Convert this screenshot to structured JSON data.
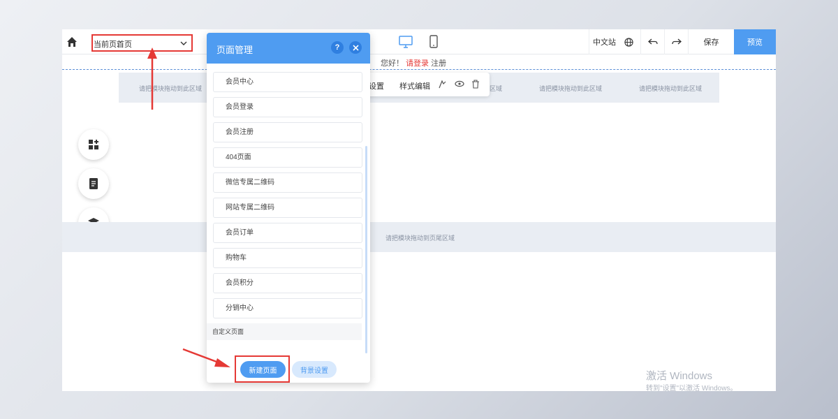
{
  "toolbar": {
    "current_page_label": "当前页:",
    "current_page_value": "首页",
    "language": "中文站",
    "save": "保存",
    "preview": "预览"
  },
  "canvas": {
    "greeting_prefix": "您好！",
    "greeting_login": "请登录",
    "greeting_register": "注册",
    "drop_hint": "请把模块拖动到此区域",
    "drop_cells": [
      "请把模块拖动到此区域",
      "请把模块拖动到此区域",
      "请把模块拖动到此区域",
      "请把模块拖动到此区域",
      "请把模块拖动到此区域"
    ],
    "footer_hint": "请把模块拖动到页尾区域"
  },
  "module_toolbar": {
    "block_settings": "块设置",
    "style_edit": "样式编辑"
  },
  "dialog": {
    "title": "页面管理",
    "help": "?",
    "pages": [
      "会员中心",
      "会员登录",
      "会员注册",
      "404页面",
      "微信专属二维码",
      "网站专属二维码",
      "会员订单",
      "购物车",
      "会员积分",
      "分销中心"
    ],
    "custom_section": "自定义页面",
    "new_page": "新建页面",
    "bg_settings": "背景设置"
  },
  "watermark": {
    "line1": "激活 Windows",
    "line2": "转到\"设置\"以激活 Windows。"
  },
  "colors": {
    "accent": "#4f9cf1",
    "highlight": "#e53935"
  }
}
